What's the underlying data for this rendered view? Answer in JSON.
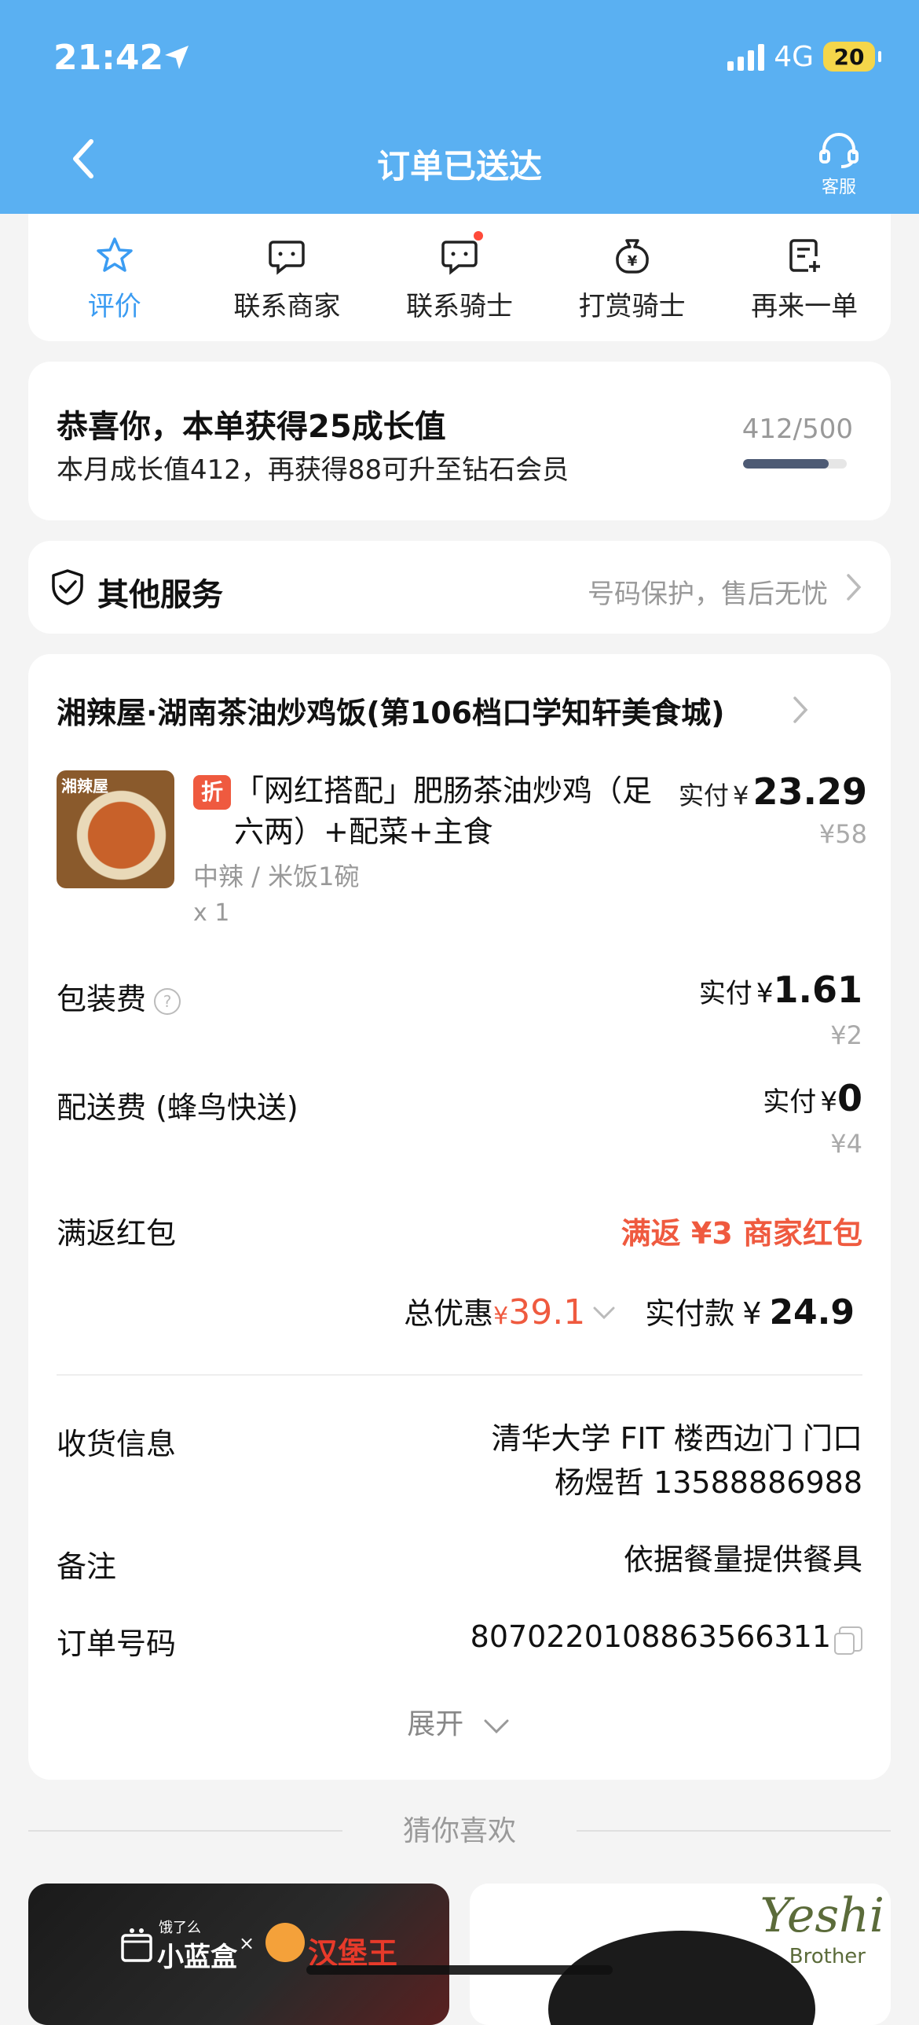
{
  "status": {
    "time": "21:42",
    "network": "4G",
    "battery": "20"
  },
  "nav": {
    "title": "订单已送达",
    "service_label": "客服"
  },
  "actions": [
    {
      "label": "评价",
      "icon": "star-icon",
      "active": true
    },
    {
      "label": "联系商家",
      "icon": "chat-icon"
    },
    {
      "label": "联系骑士",
      "icon": "chat-icon",
      "badge": true
    },
    {
      "label": "打赏骑士",
      "icon": "money-bag-icon"
    },
    {
      "label": "再来一单",
      "icon": "reorder-icon"
    }
  ],
  "growth": {
    "title": "恭喜你，本单获得25成长值",
    "subtitle": "本月成长值412，再获得88可升至钻石会员",
    "count": "412/500",
    "progress": 0.824
  },
  "services": {
    "title": "其他服务",
    "note": "号码保护，售后无忧"
  },
  "order": {
    "shop_name": "湘辣屋·湖南茶油炒鸡饭(第106档口学知轩美食城)",
    "item": {
      "image_tag": "湘辣屋",
      "badge": "折",
      "name": "「网红搭配」肥肠茶油炒鸡（足六两）+配菜+主食",
      "spec": "中辣 / 米饭1碗",
      "qty": "x 1",
      "paid_label": "实付",
      "currency": "¥",
      "paid": "23.29",
      "original": "¥58"
    },
    "packing": {
      "label": "包装费",
      "help": "?",
      "paid_label": "实付",
      "currency": "¥",
      "paid": "1.61",
      "original": "¥2"
    },
    "delivery": {
      "label": "配送费 (蜂鸟快送)",
      "paid_label": "实付",
      "currency": "¥",
      "paid": "0",
      "original": "¥4"
    },
    "redpack": {
      "label": "满返红包",
      "value": "满返 ¥3 商家红包"
    },
    "totals": {
      "discount_label": "总优惠",
      "currency": "¥",
      "discount": "39.1",
      "paid_label": "实付款",
      "paid": "24.9"
    },
    "receiver": {
      "label": "收货信息",
      "address": "清华大学 FIT 楼西边门 门口",
      "contact": "杨煜哲 13588886988"
    },
    "remark": {
      "label": "备注",
      "value": "依据餐量提供餐具"
    },
    "order_no": {
      "label": "订单号码",
      "value": "8070220108863566311"
    },
    "expand_label": "展开"
  },
  "recommend": {
    "title": "猜你喜欢",
    "left": {
      "eleme": "饿了么",
      "brand": "小蓝盒",
      "x": "×",
      "partner": "汉堡王"
    },
    "right": {
      "brand": "Yeshi",
      "sub": "Brother"
    }
  },
  "colors": {
    "header": "#5ab0f2",
    "accent": "#3b9cf2",
    "price_red": "#ef5a3f"
  }
}
